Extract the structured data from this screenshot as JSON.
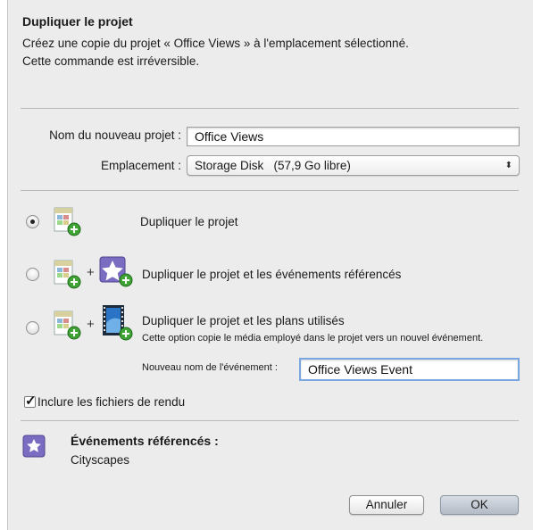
{
  "dialog": {
    "title": "Dupliquer le projet",
    "description": "Créez une copie du projet « Office Views » à l'emplacement sélectionné.\nCette commande est irréversible."
  },
  "form": {
    "name_label": "Nom du nouveau projet :",
    "name_value": "Office Views",
    "location_label": "Emplacement :",
    "location_value": "Storage Disk   (57,9 Go libre)"
  },
  "options": [
    {
      "label": "Dupliquer le projet",
      "selected": true,
      "icon": "project-add-icon"
    },
    {
      "label": "Dupliquer le projet et les événements référencés",
      "selected": false,
      "icon": "event-star-add-icon"
    },
    {
      "label": "Dupliquer le projet et les plans utilisés",
      "selected": false,
      "icon": "film-clip-add-icon",
      "sublabel": "Cette option copie le média employé dans le projet vers un nouvel événement."
    }
  ],
  "event_name": {
    "label": "Nouveau nom de l'événement :",
    "value": "Office Views Event"
  },
  "include_render": {
    "label": "Inclure les fichiers de rendu",
    "checked": true
  },
  "referenced_events": {
    "title": "Événements référencés :",
    "value": "Cityscapes",
    "icon": "star-event-icon"
  },
  "buttons": {
    "cancel": "Annuler",
    "ok": "OK"
  },
  "colors": {
    "accent": "#7a6cc1",
    "green_badge": "#3fa435"
  }
}
